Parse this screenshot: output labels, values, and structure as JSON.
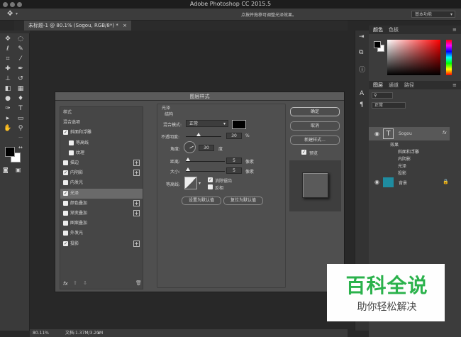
{
  "app": {
    "title": "Adobe Photoshop CC 2015.5",
    "hint": "点按并拖移可调整光泽效果。",
    "workspace": "基本功能"
  },
  "doc_tab": {
    "label": "未标题-1 @ 80.1% (Sogou, RGB/8*) *"
  },
  "status": {
    "zoom": "80.11%",
    "doc": "文档:1.37M/3.20M"
  },
  "panels": {
    "color_tabs": [
      "颜色",
      "色板"
    ],
    "layer_tabs": [
      "图层",
      "通道",
      "路径"
    ],
    "blend_mode": "正常",
    "layers": [
      {
        "name": "Sogou",
        "fx": "fx"
      },
      {
        "name": "背景"
      }
    ],
    "effects_header": "效果",
    "effects": [
      "斜面和浮雕",
      "内阴影",
      "光泽",
      "投影"
    ]
  },
  "dialog": {
    "title": "图层样式",
    "styles": [
      {
        "label": "样式",
        "check": false,
        "plus": false,
        "cb": false
      },
      {
        "label": "混合选项",
        "check": false,
        "plus": false,
        "cb": false
      },
      {
        "label": "斜面和浮雕",
        "check": true,
        "plus": false,
        "cb": true
      },
      {
        "label": "等高线",
        "check": false,
        "plus": false,
        "cb": true,
        "indent": true
      },
      {
        "label": "纹理",
        "check": false,
        "plus": false,
        "cb": true,
        "indent": true
      },
      {
        "label": "描边",
        "check": false,
        "plus": true,
        "cb": true
      },
      {
        "label": "内阴影",
        "check": true,
        "plus": true,
        "cb": true
      },
      {
        "label": "内发光",
        "check": false,
        "plus": false,
        "cb": true
      },
      {
        "label": "光泽",
        "check": true,
        "plus": false,
        "cb": true,
        "selected": true
      },
      {
        "label": "颜色叠加",
        "check": false,
        "plus": true,
        "cb": true
      },
      {
        "label": "渐变叠加",
        "check": false,
        "plus": true,
        "cb": true
      },
      {
        "label": "图案叠加",
        "check": false,
        "plus": false,
        "cb": true
      },
      {
        "label": "外发光",
        "check": false,
        "plus": false,
        "cb": true
      },
      {
        "label": "投影",
        "check": true,
        "plus": true,
        "cb": true
      }
    ],
    "section": "光泽",
    "structure": "结构",
    "blend_label": "混合模式:",
    "blend_value": "正常",
    "opacity_label": "不透明度:",
    "opacity_value": "30",
    "percent": "%",
    "angle_label": "角度:",
    "angle_value": "30",
    "degree": "度",
    "distance_label": "距离:",
    "distance_value": "5",
    "size_label": "大小:",
    "size_value": "5",
    "px": "像素",
    "contour_label": "等高线:",
    "antialias_label": "消除锯齿",
    "invert_label": "反相",
    "set_default": "设置为默认值",
    "reset_default": "复位为默认值",
    "ok": "确定",
    "cancel": "取消",
    "new_style": "新建样式...",
    "preview": "预览",
    "fx": "fx"
  },
  "watermark": {
    "main": "百科全说",
    "sub": "助你轻松解决"
  },
  "colors": {
    "accent": "#2b8fd9",
    "layer_bg": "#1f8ca0"
  }
}
